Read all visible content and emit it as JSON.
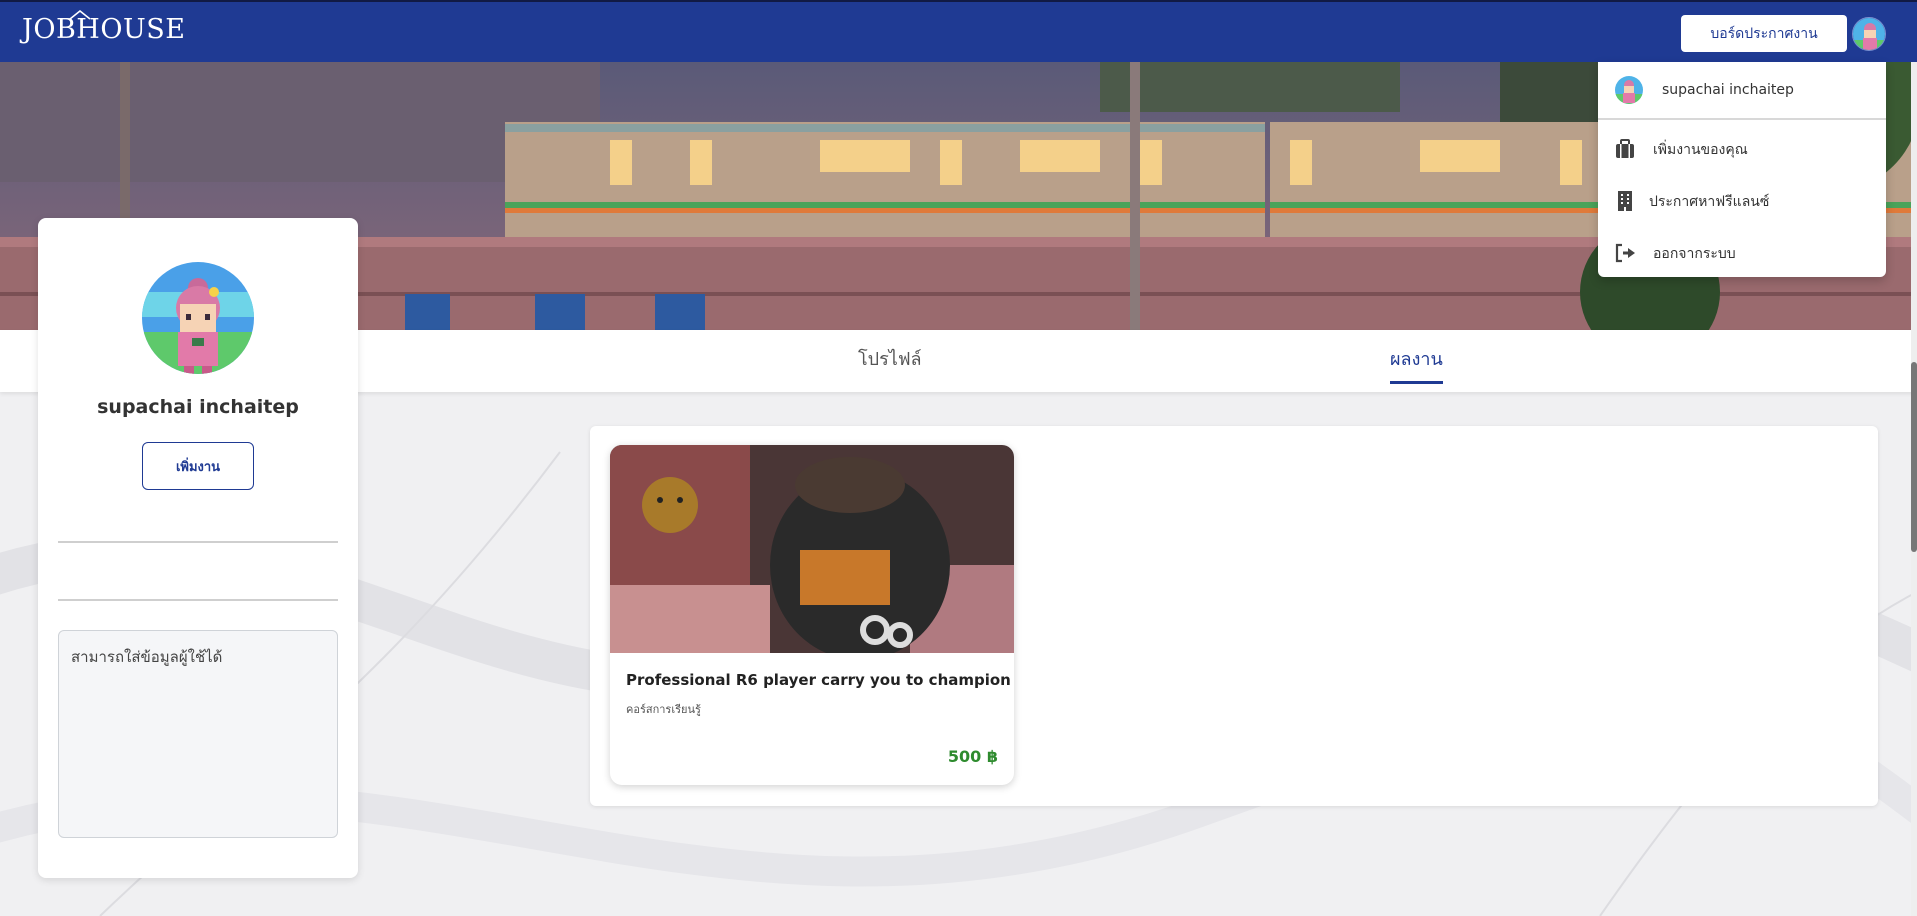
{
  "app": {
    "logo": "JOBHOUSE"
  },
  "navbar": {
    "board_button": "บอร์ดประกาศงาน"
  },
  "dropdown": {
    "user_name": "supachai inchaitep",
    "items": [
      {
        "label": "เพิ่มงานของคุณ",
        "icon": "briefcase-icon"
      },
      {
        "label": "ประกาศหาฟรีแลนซ์",
        "icon": "building-icon"
      },
      {
        "label": "ออกจากระบบ",
        "icon": "logout-icon"
      }
    ]
  },
  "tabs": [
    {
      "label": "โปรไฟล์",
      "active": false
    },
    {
      "label": "ผลงาน",
      "active": true
    }
  ],
  "profile": {
    "name": "supachai inchaitep",
    "add_work_label": "เพิ่มงาน",
    "bio_placeholder": "สามารถใส่ข้อมูลผู้ใช้ได้"
  },
  "works": [
    {
      "title": "Professional R6 player carry you to champion",
      "category": "คอร์สการเรียนรู้",
      "price": "500 ฿"
    }
  ],
  "colors": {
    "primary": "#1f3a93",
    "price": "#2e8b2e"
  }
}
